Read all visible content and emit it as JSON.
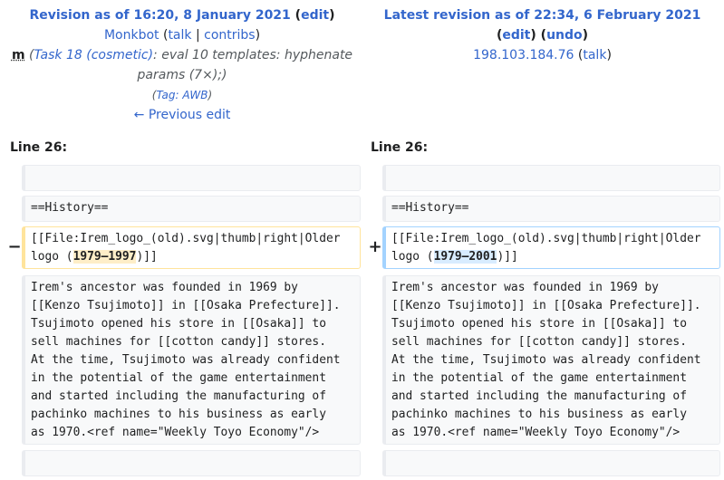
{
  "left": {
    "title_link": "Revision as of 16:20, 8 January 2021",
    "edit": "edit",
    "user": "Monkbot",
    "talk": "talk",
    "contribs": "contribs",
    "minor_flag": "m",
    "summary_link": "Task 18 (cosmetic)",
    "summary_text": ": eval 10 templates: hyphenate params (7×);)",
    "tag_prefix": "Tag: ",
    "tag_link": "AWB",
    "prev_link": "← Previous edit",
    "line_label": "Line 26:"
  },
  "right": {
    "title_link": "Latest revision as of 22:34, 6 February 2021",
    "edit": "edit",
    "undo": "undo",
    "user": "198.103.184.76",
    "talk": "talk",
    "line_label": "Line 26:"
  },
  "diff": {
    "del_marker": "−",
    "add_marker": "+",
    "heading": "==History==",
    "file_pre": "[[File:Irem_logo_(old).svg|thumb|right|Older\nlogo (",
    "file_post": ")]]",
    "old_years": "1979–1997",
    "new_years": "1979–2001",
    "paragraph": "Irem's ancestor was founded in 1969 by\n[[Kenzo Tsujimoto]] in [[Osaka Prefecture]].\nTsujimoto opened his store in [[Osaka]] to\nsell machines for [[cotton candy]] stores.\nAt the time, Tsujimoto was already confident\nin the potential of the game entertainment\nand started including the manufacturing of\npachinko machines to his business as early\nas 1970.<ref name=\"Weekly Toyo Economy\"/>"
  }
}
